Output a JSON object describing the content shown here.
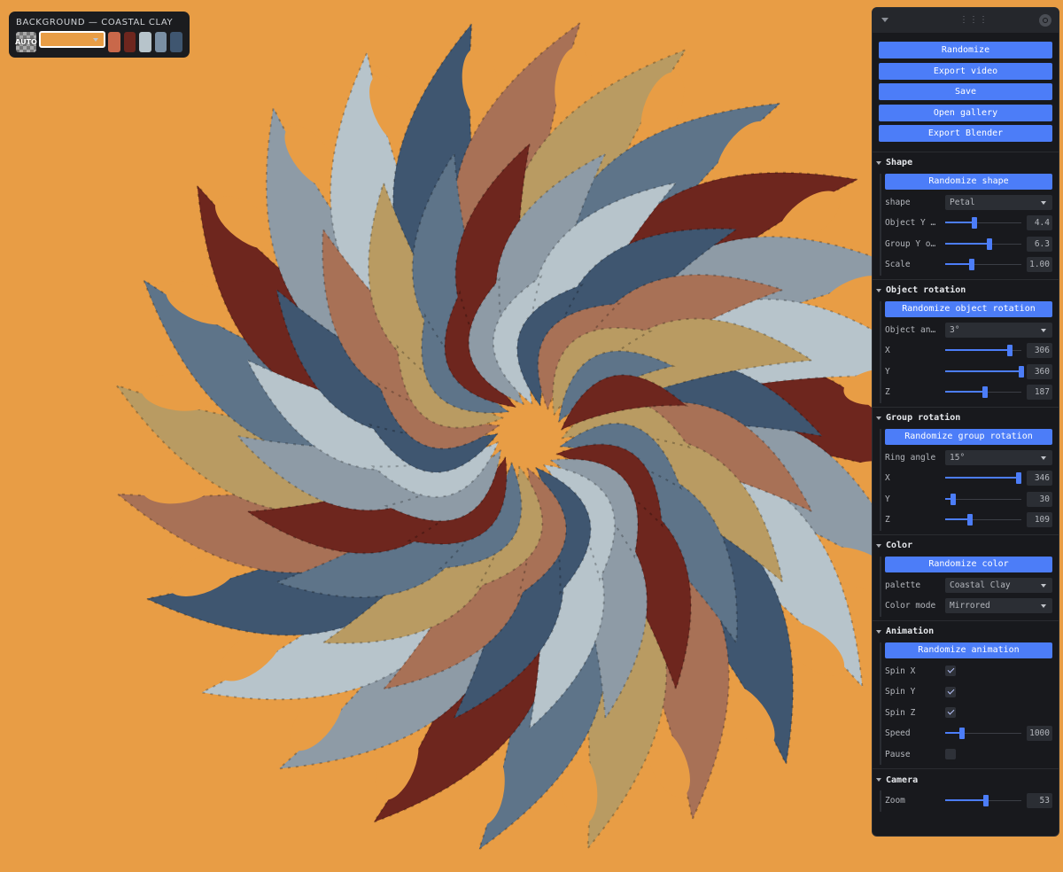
{
  "background_picker": {
    "title": "BACKGROUND — COASTAL CLAY",
    "swatches": [
      {
        "name": "auto",
        "label": "AUTO"
      },
      {
        "name": "orange",
        "color": "#E89D45",
        "selected": true
      },
      {
        "name": "terracotta",
        "color": "#C9684A"
      },
      {
        "name": "oxblood",
        "color": "#6E261E"
      },
      {
        "name": "pale-blue",
        "color": "#B7C4CB"
      },
      {
        "name": "slate-blue",
        "color": "#7A8FA4"
      },
      {
        "name": "navy-slate",
        "color": "#3F5670"
      }
    ]
  },
  "panel": {
    "actions": [
      "Randomize",
      "Export video",
      "Save",
      "Open gallery",
      "Export Blender"
    ],
    "shape": {
      "title": "Shape",
      "randomize": "Randomize shape",
      "shape_label": "shape",
      "shape_value": "Petal",
      "objy_label": "Object Y …",
      "objy_value": "4.4",
      "groupy_label": "Group Y o…",
      "groupy_value": "6.3",
      "scale_label": "Scale",
      "scale_value": "1.00"
    },
    "object_rotation": {
      "title": "Object rotation",
      "randomize": "Randomize object rotation",
      "angle_label": "Object an…",
      "angle_value": "3°",
      "x_label": "X",
      "x_value": "306",
      "y_label": "Y",
      "y_value": "360",
      "z_label": "Z",
      "z_value": "187"
    },
    "group_rotation": {
      "title": "Group rotation",
      "randomize": "Randomize group rotation",
      "ring_label": "Ring angle",
      "ring_value": "15°",
      "x_label": "X",
      "x_value": "346",
      "y_label": "Y",
      "y_value": "30",
      "z_label": "Z",
      "z_value": "109"
    },
    "color": {
      "title": "Color",
      "randomize": "Randomize color",
      "palette_label": "palette",
      "palette_value": "Coastal Clay",
      "mode_label": "Color mode",
      "mode_value": "Mirrored"
    },
    "animation": {
      "title": "Animation",
      "randomize": "Randomize animation",
      "spinx_label": "Spin X",
      "spinx_checked": true,
      "spiny_label": "Spin Y",
      "spiny_checked": true,
      "spinz_label": "Spin Z",
      "spinz_checked": true,
      "speed_label": "Speed",
      "speed_value": "1000",
      "pause_label": "Pause",
      "pause_checked": false
    },
    "camera": {
      "title": "Camera",
      "zoom_label": "Zoom",
      "zoom_value": "53"
    }
  },
  "slider_levels": {
    "objy": 0.38,
    "groupy": 0.58,
    "scale": 0.35,
    "orx": 0.85,
    "ory": 1.0,
    "orz": 0.52,
    "grx": 0.96,
    "gry": 0.1,
    "grz": 0.33,
    "speed": 0.22,
    "zoom": 0.53
  },
  "colors": {
    "background": "#E89D45",
    "accent": "#4C7DF8",
    "petal_palette": [
      "#6E261E",
      "#8E9BA6",
      "#B7C4CB",
      "#3F5670",
      "#A87156",
      "#B99B62",
      "#5E7489"
    ]
  }
}
